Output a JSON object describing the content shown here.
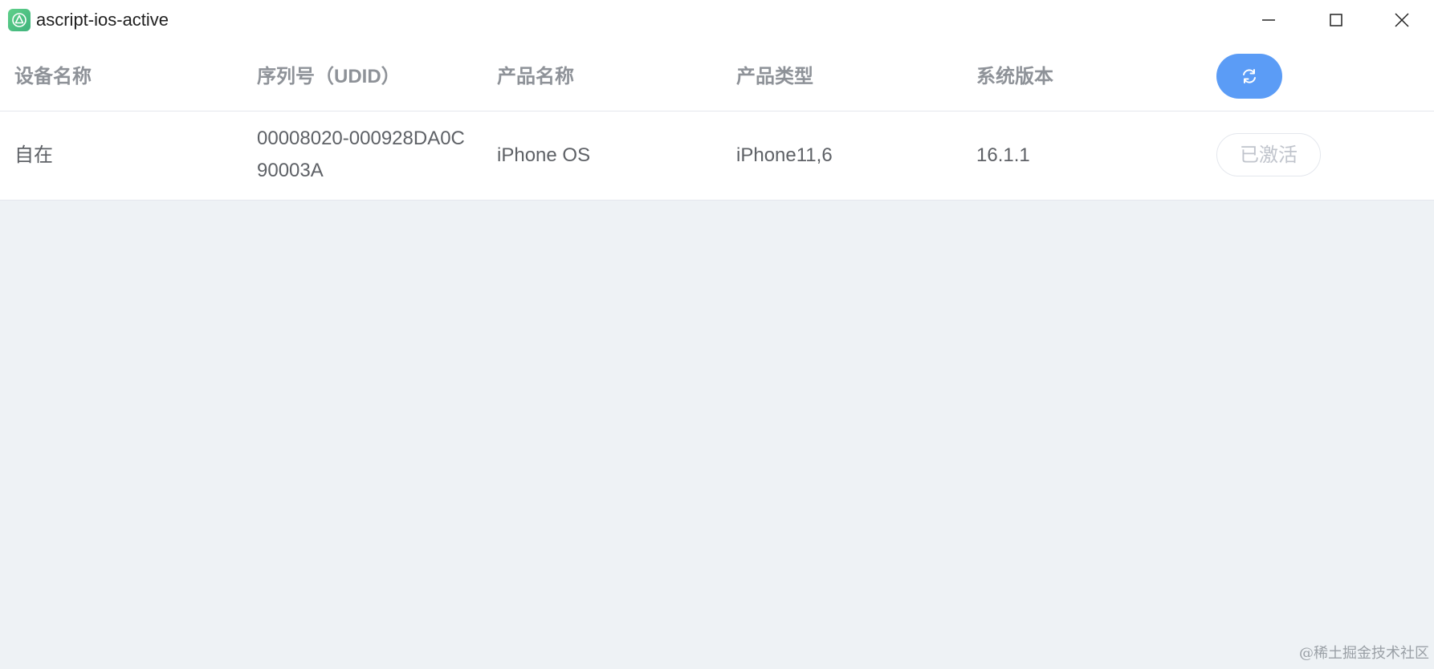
{
  "window": {
    "title": "ascript-ios-active"
  },
  "table": {
    "headers": {
      "device_name": "设备名称",
      "udid": "序列号（UDID）",
      "product_name": "产品名称",
      "product_type": "产品类型",
      "os_version": "系统版本"
    },
    "rows": [
      {
        "device_name": "自在",
        "udid": "00008020-000928DA0C90003A",
        "product_name": "iPhone OS",
        "product_type": "iPhone11,6",
        "os_version": "16.1.1",
        "action_label": "已激活"
      }
    ]
  },
  "watermark": "@稀土掘金技术社区",
  "colors": {
    "accent": "#5b9cf6",
    "header_text": "#8e9298",
    "cell_text": "#5e6166",
    "page_bg": "#eef2f5",
    "disabled_text": "#c0c4cc"
  },
  "icons": {
    "app": "ascript-logo-icon",
    "refresh": "refresh-icon",
    "minimize": "minimize-icon",
    "maximize": "maximize-icon",
    "close": "close-icon"
  }
}
